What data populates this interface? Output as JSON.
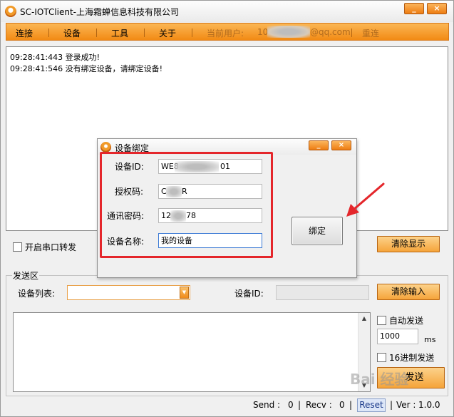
{
  "window": {
    "title": "SC-IOTClient-上海霜蝉信息科技有限公司",
    "controls": {
      "minimize": "_",
      "close": "×"
    }
  },
  "menu": {
    "items": [
      "连接",
      "设备",
      "工具",
      "关于"
    ],
    "current_user_label": "当前用户:",
    "current_user_prefix": "10",
    "current_user_suffix": "@qq.com",
    "reconnect": "重连"
  },
  "log": {
    "lines": [
      "09:28:41:443 登录成功!",
      "09:28:41:546 没有绑定设备，请绑定设备!"
    ]
  },
  "serial_forward": {
    "label": "开启串口转发",
    "checked": false
  },
  "clear_display_button": "清除显示",
  "send_section": {
    "title": "发送区",
    "device_list_label": "设备列表:",
    "device_list_value": "",
    "device_id_label": "设备ID:",
    "device_id_value": "",
    "clear_input_button": "清除输入",
    "auto_send_label": "自动发送",
    "auto_send_checked": false,
    "interval_value": "1000",
    "interval_unit": "ms",
    "hex_send_label": "16进制发送",
    "hex_send_checked": false,
    "send_button": "发送"
  },
  "status_bar": {
    "send_label": "Send :",
    "send_value": "0",
    "recv_label": "Recv :",
    "recv_value": "0",
    "reset_button": "Reset",
    "version_label": "Ver :",
    "version_value": "1.0.0"
  },
  "watermark": "Bai 经验",
  "dialog": {
    "title": "设备绑定",
    "controls": {
      "minimize": "_",
      "close": "×"
    },
    "fields": [
      {
        "label": "设备ID:",
        "value_prefix": "WE8",
        "value_suffix": "01"
      },
      {
        "label": "授权码:",
        "value_prefix": "C",
        "value_suffix": "R"
      },
      {
        "label": "通讯密码:",
        "value_prefix": "12",
        "value_suffix": "78"
      },
      {
        "label": "设备名称:",
        "value_prefix": "我的设备",
        "value_suffix": ""
      }
    ],
    "bind_button": "绑定"
  },
  "annotation": {
    "highlight_color": "#e4262b"
  }
}
